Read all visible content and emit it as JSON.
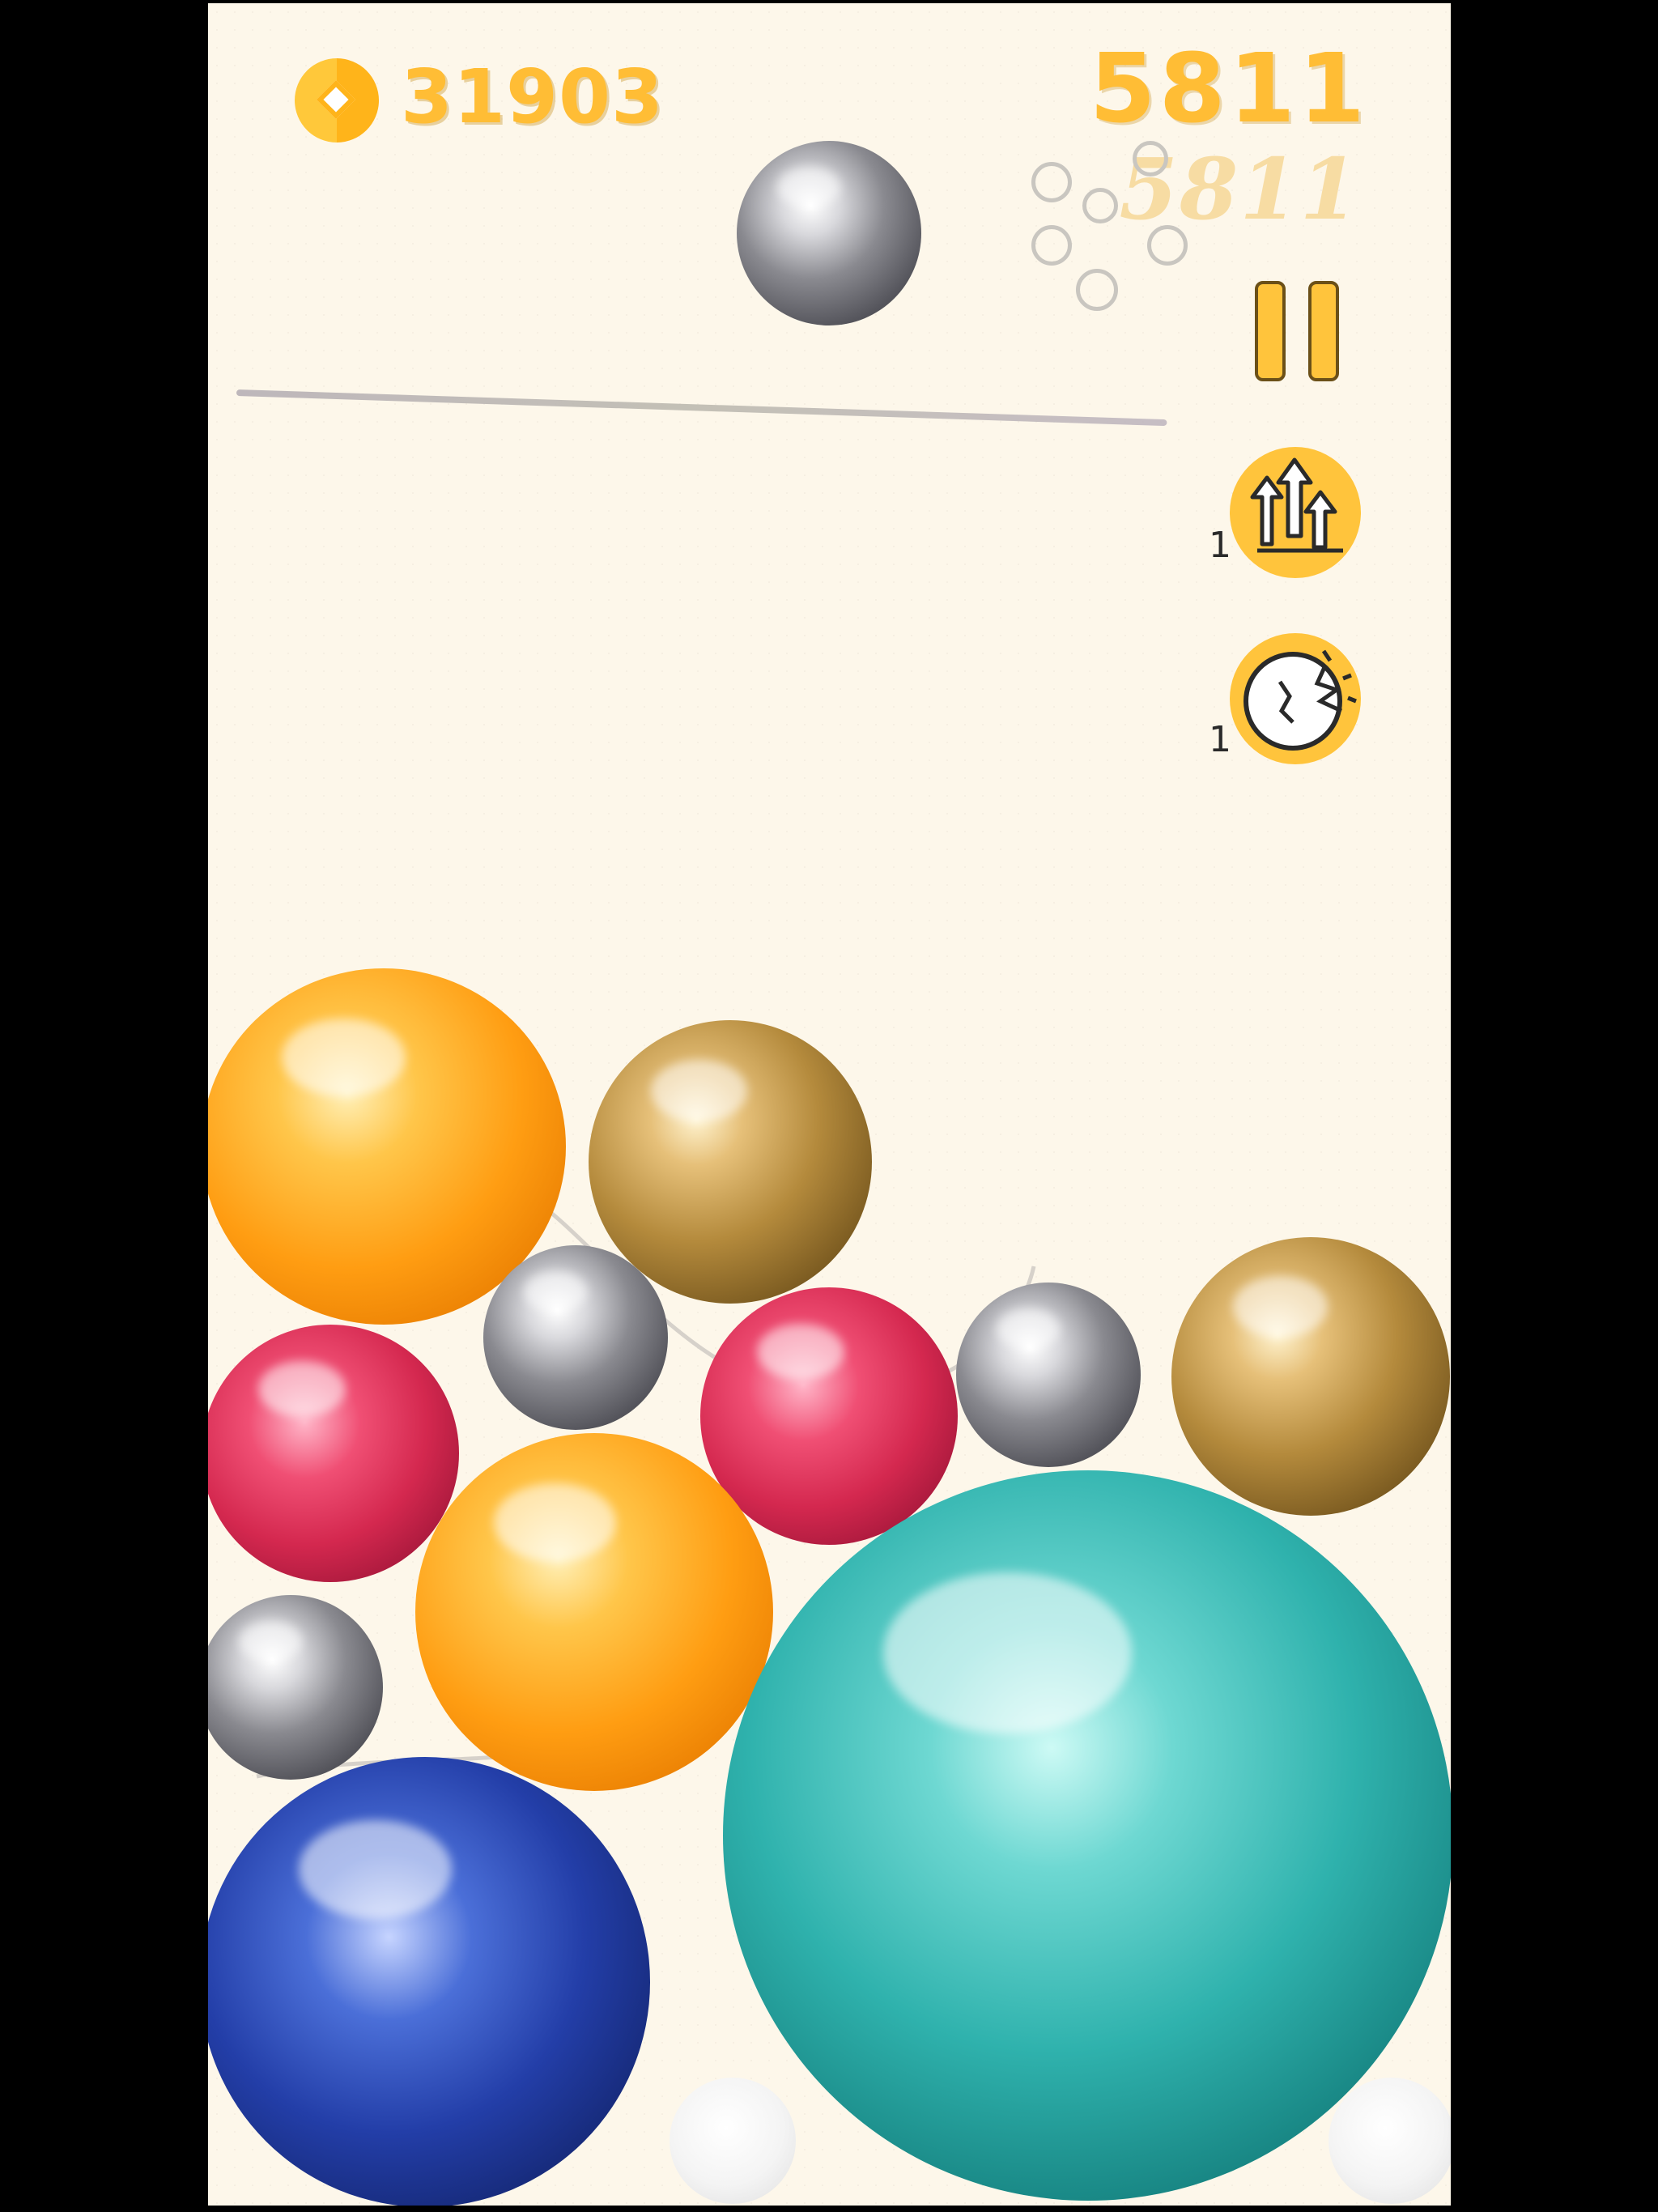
{
  "hud": {
    "coins": "31903",
    "score": "5811",
    "best_score": "5811"
  },
  "powerups": [
    {
      "name": "upgrade",
      "count": "1",
      "icon": "arrows-up-icon"
    },
    {
      "name": "smash",
      "count": "1",
      "icon": "shatter-ball-icon"
    }
  ],
  "colors": {
    "background": "#fdf7ea",
    "accent": "#ffbd35",
    "best_score": "#f7dca3"
  },
  "next_ball": "silver",
  "balls": [
    "silver",
    "orange",
    "gold",
    "silver",
    "ruby",
    "ruby",
    "silver",
    "gold",
    "orange",
    "silver",
    "teal",
    "blue",
    "white",
    "white"
  ]
}
